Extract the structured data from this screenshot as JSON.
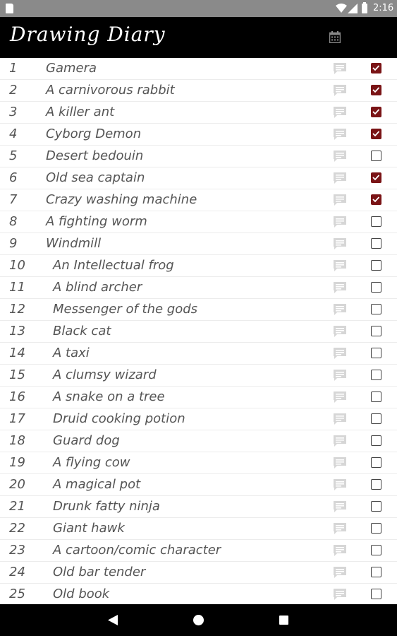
{
  "status_bar": {
    "time": "2:16"
  },
  "app_bar": {
    "title": "Drawing Diary",
    "calendar_icon": "calendar-icon"
  },
  "colors": {
    "checked": "#7a1416",
    "app_bar": "#000000",
    "status_bar": "#8a8a8a"
  },
  "items": [
    {
      "num": "1",
      "title": "Gamera",
      "checked": true
    },
    {
      "num": "2",
      "title": "A carnivorous rabbit",
      "checked": true
    },
    {
      "num": "3",
      "title": "A killer ant",
      "checked": true
    },
    {
      "num": "4",
      "title": "Cyborg Demon",
      "checked": true
    },
    {
      "num": "5",
      "title": "Desert bedouin",
      "checked": false
    },
    {
      "num": "6",
      "title": "Old sea captain",
      "checked": true
    },
    {
      "num": "7",
      "title": "Crazy washing machine",
      "checked": true
    },
    {
      "num": "8",
      "title": "A fighting worm",
      "checked": false
    },
    {
      "num": "9",
      "title": "Windmill",
      "checked": false
    },
    {
      "num": "10",
      "title": "An Intellectual frog",
      "checked": false
    },
    {
      "num": "11",
      "title": "A blind archer",
      "checked": false
    },
    {
      "num": "12",
      "title": "Messenger of the gods",
      "checked": false
    },
    {
      "num": "13",
      "title": "Black cat",
      "checked": false
    },
    {
      "num": "14",
      "title": "A taxi",
      "checked": false
    },
    {
      "num": "15",
      "title": "A clumsy wizard",
      "checked": false
    },
    {
      "num": "16",
      "title": "A snake on a tree",
      "checked": false
    },
    {
      "num": "17",
      "title": "Druid cooking potion",
      "checked": false
    },
    {
      "num": "18",
      "title": "Guard dog",
      "checked": false
    },
    {
      "num": "19",
      "title": "A flying cow",
      "checked": false
    },
    {
      "num": "20",
      "title": "A magical pot",
      "checked": false
    },
    {
      "num": "21",
      "title": "Drunk fatty ninja",
      "checked": false
    },
    {
      "num": "22",
      "title": "Giant hawk",
      "checked": false
    },
    {
      "num": "23",
      "title": "A cartoon/comic character",
      "checked": false
    },
    {
      "num": "24",
      "title": "Old bar tender",
      "checked": false
    },
    {
      "num": "25",
      "title": "Old book",
      "checked": false
    }
  ]
}
